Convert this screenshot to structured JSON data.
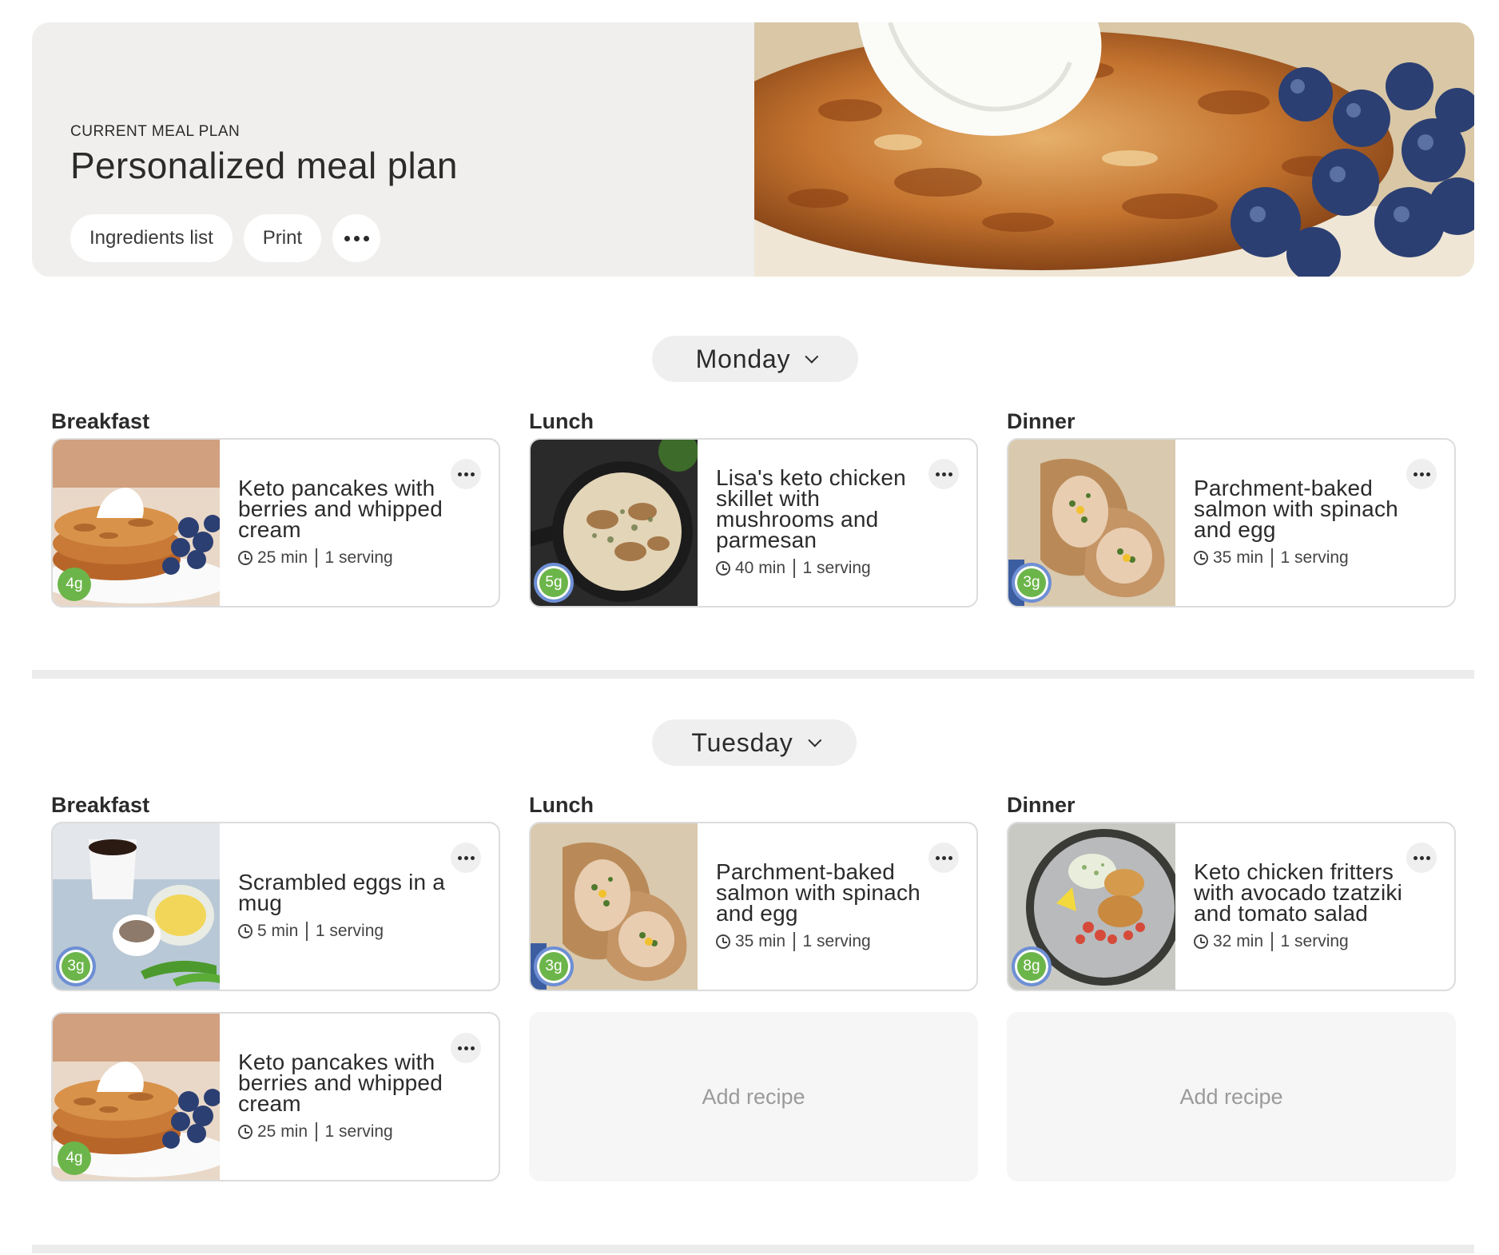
{
  "hero": {
    "eyebrow": "CURRENT MEAL PLAN",
    "title": "Personalized meal plan",
    "ingredients_label": "Ingredients list",
    "print_label": "Print",
    "more_icon": "more-dots-icon"
  },
  "colors": {
    "badge_green": "#6cb54a",
    "badge_ring": "#6e8fd6",
    "card_border": "#dcdcdc",
    "hero_bg": "#f0efed"
  },
  "days": [
    {
      "name": "Monday",
      "meals": {
        "breakfast_label": "Breakfast",
        "lunch_label": "Lunch",
        "dinner_label": "Dinner",
        "breakfast": [
          {
            "title": "Keto pancakes with berries and whipped cream",
            "time": "25 min",
            "servings": "1 serving",
            "carbs": "4g"
          }
        ],
        "lunch": [
          {
            "title": "Lisa's keto chicken skillet with mushrooms and parmesan",
            "time": "40 min",
            "servings": "1 serving",
            "carbs": "5g"
          }
        ],
        "dinner": [
          {
            "title": "Parchment-baked salmon with spinach and egg",
            "time": "35 min",
            "servings": "1 serving",
            "carbs": "3g"
          }
        ]
      }
    },
    {
      "name": "Tuesday",
      "meals": {
        "breakfast_label": "Breakfast",
        "lunch_label": "Lunch",
        "dinner_label": "Dinner",
        "breakfast": [
          {
            "title": "Scrambled eggs in a mug",
            "time": "5 min",
            "servings": "1 serving",
            "carbs": "3g"
          },
          {
            "title": "Keto pancakes with berries and whipped cream",
            "time": "25 min",
            "servings": "1 serving",
            "carbs": "4g"
          }
        ],
        "lunch": [
          {
            "title": "Parchment-baked salmon with spinach and egg",
            "time": "35 min",
            "servings": "1 serving",
            "carbs": "3g"
          }
        ],
        "dinner": [
          {
            "title": "Keto chicken fritters with avocado tzatziki and tomato salad",
            "time": "32 min",
            "servings": "1 serving",
            "carbs": "8g"
          }
        ],
        "add_lunch": "Add recipe",
        "add_dinner": "Add recipe"
      }
    }
  ]
}
